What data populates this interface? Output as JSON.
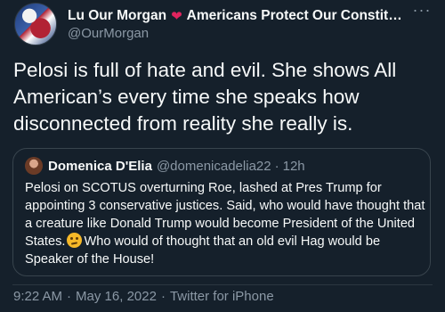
{
  "author": {
    "display_name": "Lu Our Morgan",
    "heart": "❤",
    "name_suffix": "Americans Protect Our Constitu...",
    "handle": "@OurMorgan"
  },
  "more_menu": "···",
  "tweet": {
    "text": "Pelosi is full of hate and evil. She shows All American’s every time she speaks how disconnected from reality she really is."
  },
  "quoted_tweet": {
    "display_name": "Domenica D'Elia",
    "handle": "@domenicadelia22",
    "separator": "·",
    "time": "12h",
    "text_before_emoji": "Pelosi on SCOTUS overturning Roe, lashed at Pres Trump for appointing 3 conservative justices. Said, who would have thought that a creature like Donald Trump would become President of the United States.",
    "emoji": "thinking-face",
    "text_after_emoji": "Who would of thought that an old evil Hag would be Speaker of the House!"
  },
  "meta": {
    "time": "9:22 AM",
    "separator1": "·",
    "date": "May 16, 2022",
    "separator2": "·",
    "source": "Twitter for iPhone"
  },
  "colors": {
    "background": "#15202b",
    "text": "#f7f9f9",
    "secondary_text": "#8b98a5",
    "heart": "#e0245e",
    "border": "#38444d"
  }
}
